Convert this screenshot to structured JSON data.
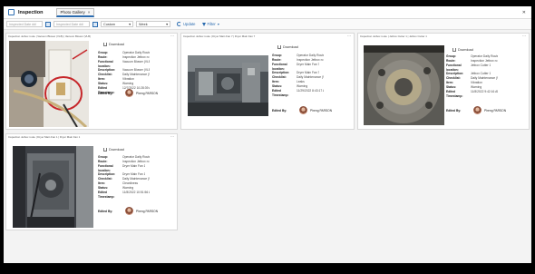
{
  "app": {
    "title": "Inspection"
  },
  "tabs": [
    {
      "label": "Photo Gallery"
    }
  ],
  "toolbar": {
    "date_from_placeholder": "Inspected Date dd/",
    "date_to_placeholder": "Inspected Date dd/",
    "range_select": "Custom",
    "period_select": "Week",
    "update_label": "Update",
    "filter_label": "Filter"
  },
  "labels": {
    "download": "Download",
    "group": "Group:",
    "route": "Route:",
    "functional_location": "Functional location:",
    "description": "Description:",
    "checklist": "Checklist:",
    "item": "Item:",
    "status": "Status:",
    "edited_timestamp": "Edited Timestamp:",
    "edited_by": "Edited By:"
  },
  "cards": [
    {
      "header": "Inspection Jetbox route | Vacuum Blower (VLB) | Vacuum Blower (VLB)",
      "group": "Operator Daily Route",
      "route": "Inspection Jetbox ro",
      "functional_location": "Vacuum Blower (VLB)",
      "description": "Vacuum Blower (VLB)",
      "checklist": "Daily Maintenance (9)",
      "item": "Vibration",
      "status": "Warning",
      "edited_timestamp": "12/7/2022 10:28:39 AM",
      "edited_by": "Pheng PARSON"
    },
    {
      "header": "Inspection Jetbox route | Dryer Main Fan 7 | Dryer Main Fan 7",
      "group": "Operator Daily Route",
      "route": "Inspection Jetbox ro",
      "functional_location": "Dryer Main Fan 7",
      "description": "Dryer Main Fan 7",
      "checklist": "Daily Maintenance (9)",
      "item": "Leaks",
      "status": "Warning",
      "edited_timestamp": "11/29/2022 8:43:17 AM",
      "edited_by": "Pheng PARSON"
    },
    {
      "header": "Inspection Jetbox route | Jetbox Cutter 1 | Jetbox Cutter 1",
      "group": "Operator Daily Route",
      "route": "Inspection Jetbox ro",
      "functional_location": "Jetbox Cutter 1",
      "description": "Jetbox Cutter 1",
      "checklist": "Daily Maintenance (9)",
      "item": "Vibration",
      "status": "Warning",
      "edited_timestamp": "11/8/2022 9:42:16 AM",
      "edited_by": "Pheng PARSON"
    },
    {
      "header": "Inspection Jetbox route | Dryer Main Fan 1 | Dryer Main Fan 1",
      "group": "Operator Daily Route",
      "route": "Inspection Jetbox ro",
      "functional_location": "Dryer Main Fan 1",
      "description": "Dryer Main Fan 1",
      "checklist": "Daily Maintenance (9)",
      "item": "Cleanliness",
      "status": "Warning",
      "edited_timestamp": "11/8/2022 10:51:56 AM",
      "edited_by": "Pheng PARSON"
    }
  ]
}
